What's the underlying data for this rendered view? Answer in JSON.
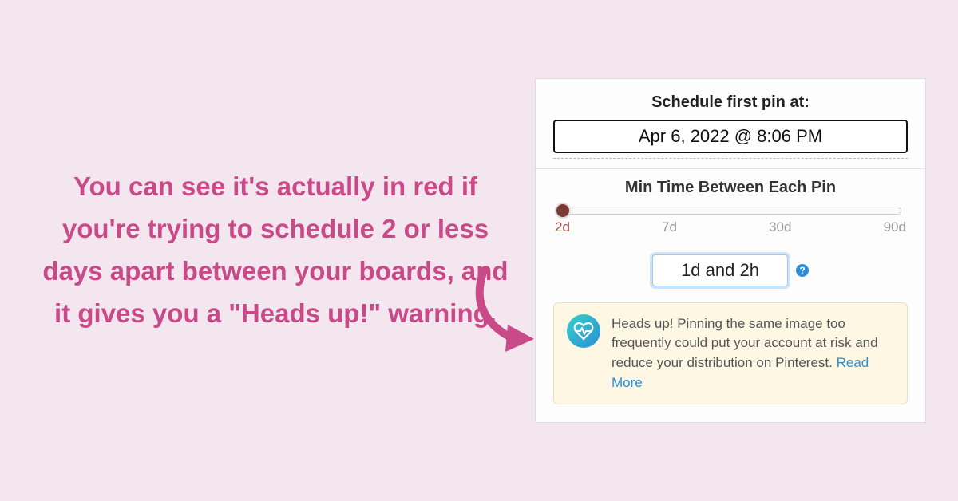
{
  "left_text": "You can see it's actually in red if you're trying to schedule 2 or less days apart between your boards, and it gives you a \"Heads up!\" warning.",
  "panel": {
    "schedule_label": "Schedule first pin at:",
    "date_value": "Apr 6, 2022 @ 8:06 PM",
    "min_label": "Min Time Between Each Pin",
    "ticks": [
      "2d",
      "7d",
      "30d",
      "90d"
    ],
    "interval_value": "1d and 2h",
    "alert_text": "Heads up! Pinning the same image too frequently could put your account at risk and reduce your distribution on Pinterest. ",
    "read_more": "Read More",
    "help_glyph": "?"
  }
}
